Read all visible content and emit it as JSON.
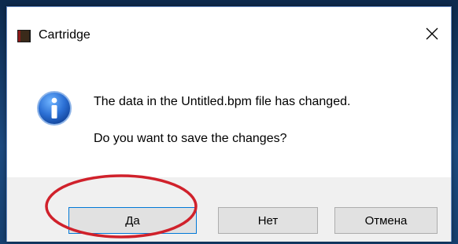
{
  "window": {
    "title": "Cartridge",
    "app_icon": "book-icon",
    "close_icon": "close-icon"
  },
  "message": {
    "icon": "info-icon",
    "line1": "The data in the Untitled.bpm file has changed.",
    "line2": "Do you want to save the changes?"
  },
  "buttons": {
    "yes_label": "Да",
    "no_label": "Нет",
    "cancel_label": "Отмена"
  },
  "annotation": {
    "shape": "ellipse",
    "color": "#d0212b",
    "target": "yes-button"
  },
  "colors": {
    "focus_border": "#0078d7",
    "footer_bg": "#f0f0f0",
    "button_bg": "#e1e1e1"
  }
}
